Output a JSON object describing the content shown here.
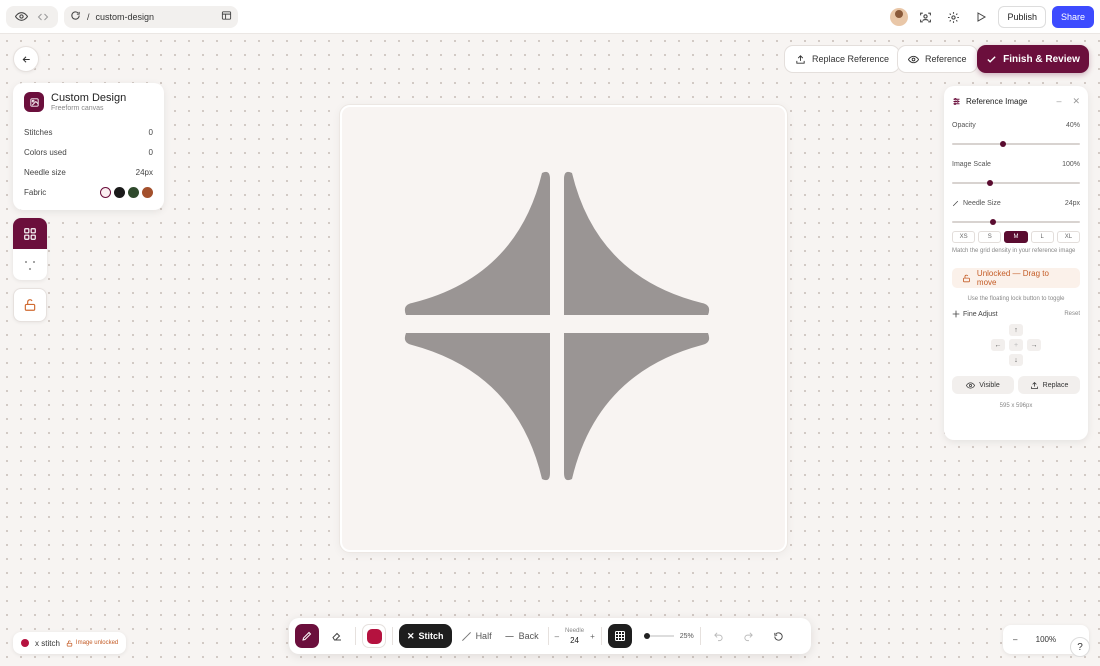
{
  "topbar": {
    "url_path": "custom-design",
    "url_prefix": "/",
    "publish_label": "Publish",
    "share_label": "Share"
  },
  "actions": {
    "replace_reference_label": "Replace Reference",
    "reference_label": "Reference",
    "finish_label": "Finish & Review"
  },
  "info": {
    "title": "Custom Design",
    "subtitle": "Freeform canvas",
    "rows": [
      {
        "label": "Stitches",
        "value": "0"
      },
      {
        "label": "Colors used",
        "value": "0"
      },
      {
        "label": "Needle size",
        "value": "24px"
      }
    ],
    "fabric_label": "Fabric",
    "fabric_colors": [
      "#fbeff1",
      "#1a1a1a",
      "#2f4a2c",
      "#a3502c"
    ]
  },
  "reference_panel": {
    "title": "Reference Image",
    "opacity_label": "Opacity",
    "opacity_value": "40%",
    "opacity_fraction": 0.4,
    "scale_label": "Image Scale",
    "scale_value": "100%",
    "scale_fraction": 0.3,
    "needle_label": "Needle Size",
    "needle_value": "24px",
    "needle_fraction": 0.32,
    "sizes": [
      "XS",
      "S",
      "M",
      "L",
      "XL"
    ],
    "active_size": "M",
    "hint": "Match the grid density in your reference image",
    "lock_status": "Unlocked — Drag to move",
    "lock_hint": "Use the floating lock button to toggle",
    "fine_adjust_label": "Fine Adjust",
    "reset_label": "Reset",
    "visible_label": "Visible",
    "replace_label": "Replace",
    "dimensions": "595 x 596px"
  },
  "toolbar": {
    "stitch_label": "Stitch",
    "half_label": "Half",
    "back_label": "Back",
    "needle_caption": "Needle",
    "needle_value": "24",
    "zoom_percent": "25%",
    "current_color": "#b5123f"
  },
  "status": {
    "stitch_type": "x stitch",
    "image_state": "Image unlocked"
  },
  "zoom": {
    "value": "100%"
  },
  "colors": {
    "accent": "#6b0f3c",
    "share": "#3d4bff",
    "reference_shape": "#9a9594"
  }
}
